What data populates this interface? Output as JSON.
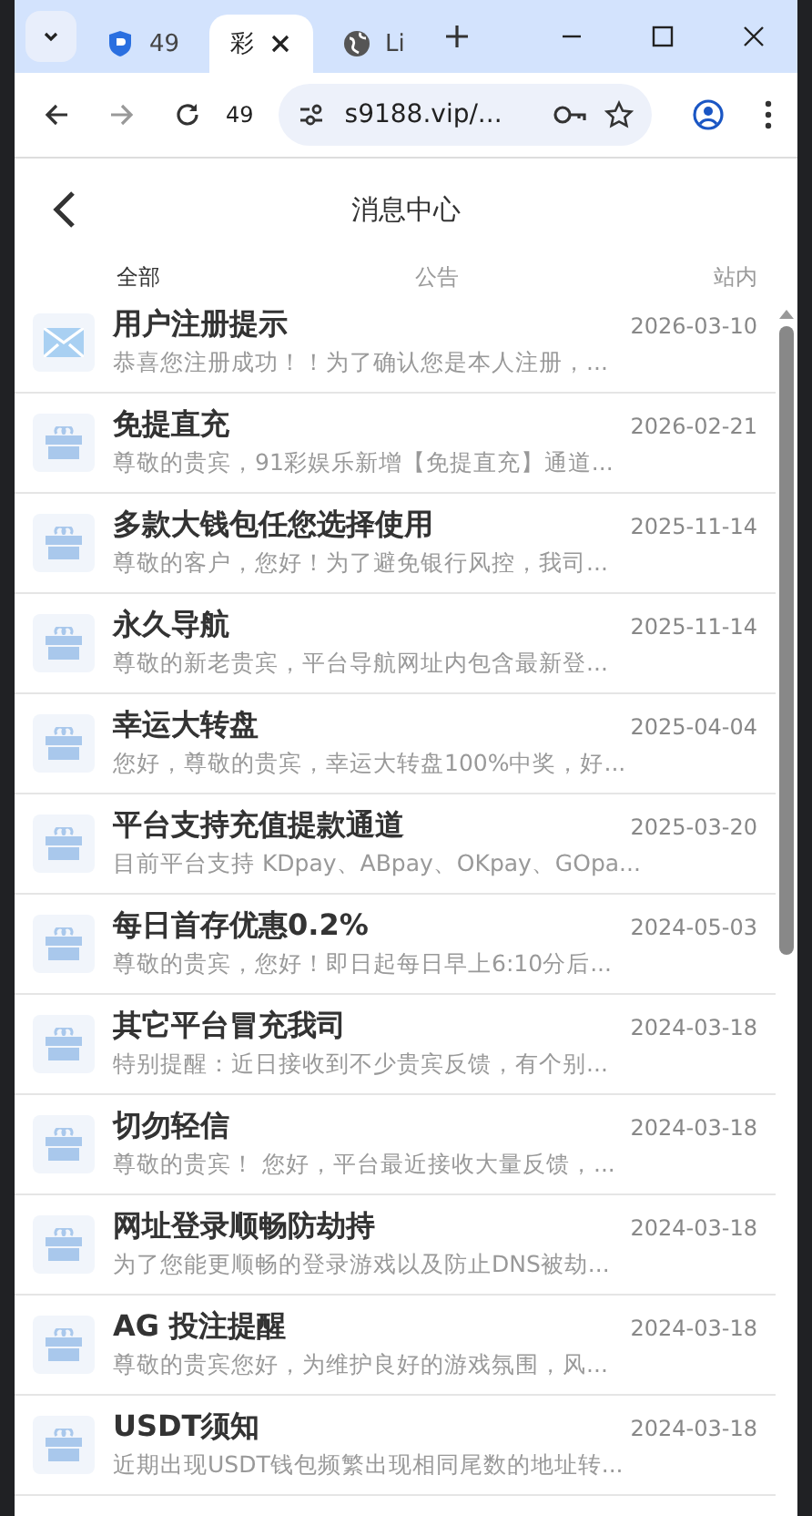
{
  "browser": {
    "tabs": [
      {
        "label": "49",
        "selected": false,
        "kind": "shield"
      },
      {
        "label": "彩",
        "selected": true,
        "kind": "none"
      },
      {
        "label": "Li",
        "selected": false,
        "kind": "globe"
      }
    ],
    "toolbar_label": "49",
    "address": "s9188.vip/..."
  },
  "header": {
    "title": "消息中心"
  },
  "tabs": [
    {
      "label": "全部",
      "selected": true
    },
    {
      "label": "公告",
      "selected": false
    },
    {
      "label": "站内",
      "selected": false
    }
  ],
  "messages": [
    {
      "kind": "mail",
      "title": "用户注册提示",
      "preview": "恭喜您注册成功！！为了确认您是本人注册，...",
      "date": "2026-03-10"
    },
    {
      "kind": "gift",
      "title": "免提直充",
      "preview": "尊敬的贵宾，91彩娱乐新增【免提直充】通道...",
      "date": "2026-02-21"
    },
    {
      "kind": "gift",
      "title": "多款大钱包任您选择使用",
      "preview": "尊敬的客户，您好！为了避免银行风控，我司...",
      "date": "2025-11-14"
    },
    {
      "kind": "gift",
      "title": "永久导航",
      "preview": "尊敬的新老贵宾，平台导航网址内包含最新登...",
      "date": "2025-11-14"
    },
    {
      "kind": "gift",
      "title": "幸运大转盘",
      "preview": "您好，尊敬的贵宾，幸运大转盘100%中奖，好...",
      "date": "2025-04-04"
    },
    {
      "kind": "gift",
      "title": "平台支持充值提款通道",
      "preview": "目前平台支持 KDpay、ABpay、OKpay、GOpa...",
      "date": "2025-03-20"
    },
    {
      "kind": "gift",
      "title": "每日首存优惠0.2%",
      "preview": "尊敬的贵宾，您好！即日起每日早上6:10分后...",
      "date": "2024-05-03"
    },
    {
      "kind": "gift",
      "title": "其它平台冒充我司",
      "preview": "特别提醒：近日接收到不少贵宾反馈，有个别...",
      "date": "2024-03-18"
    },
    {
      "kind": "gift",
      "title": "切勿轻信",
      "preview": "尊敬的贵宾！ 您好，平台最近接收大量反馈，...",
      "date": "2024-03-18"
    },
    {
      "kind": "gift",
      "title": "网址登录顺畅防劫持",
      "preview": "为了您能更顺畅的登录游戏以及防止DNS被劫...",
      "date": "2024-03-18"
    },
    {
      "kind": "gift",
      "title": "AG 投注提醒",
      "preview": "尊敬的贵宾您好，为维护良好的游戏氛围，风...",
      "date": "2024-03-18"
    },
    {
      "kind": "gift",
      "title": "USDT须知",
      "preview": "近期出现USDT钱包频繁出现相同尾数的地址转...",
      "date": "2024-03-18"
    }
  ]
}
